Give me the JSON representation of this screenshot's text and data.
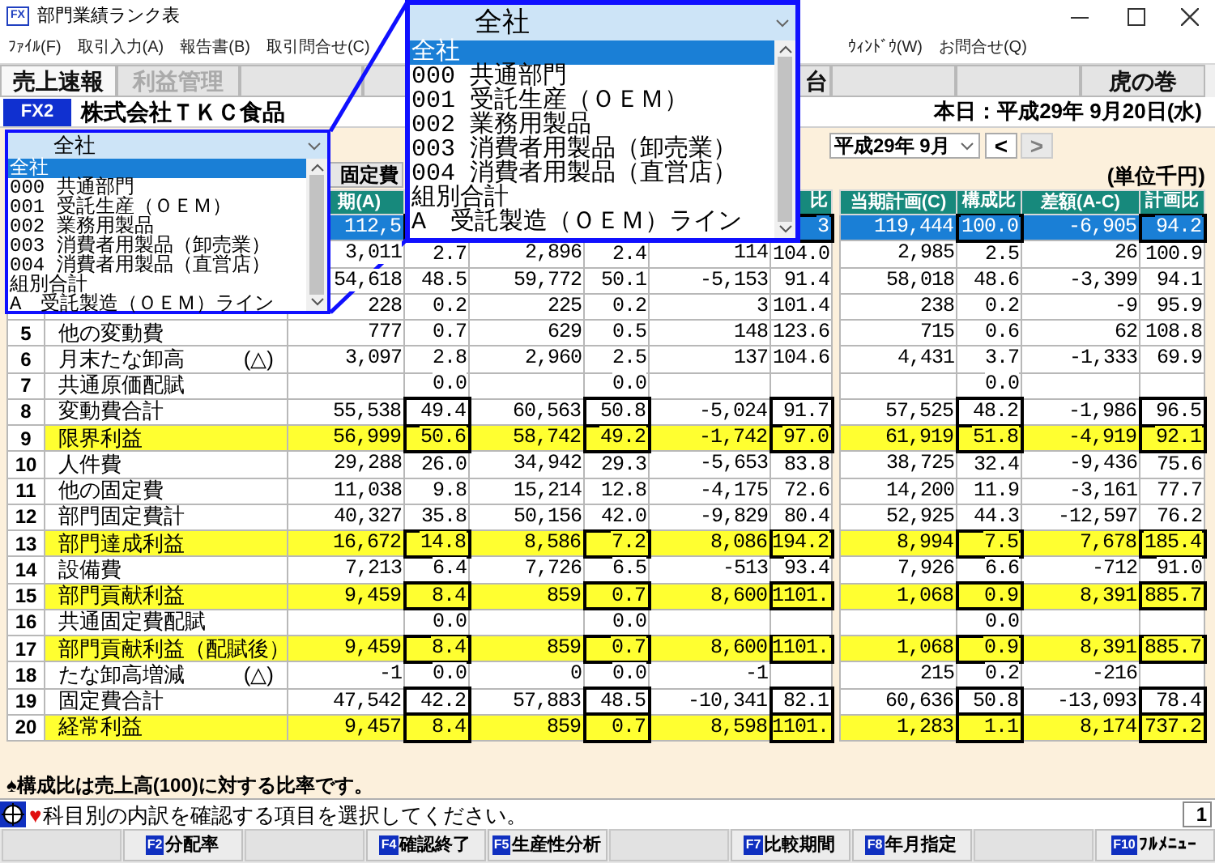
{
  "window": {
    "icon_label": "FX",
    "title": "部門業績ランク表"
  },
  "menu": [
    "ﾌｧｲﾙ(F)",
    "取引入力(A)",
    "報告書(B)",
    "取引問合せ(C)",
    "ｳｨﾝﾄﾞｳ(W)",
    "お問合せ(Q)"
  ],
  "tabs": [
    {
      "kind": "tab",
      "label": "売上速報",
      "selected": true,
      "disabled": false
    },
    {
      "kind": "tab",
      "label": "利益管理",
      "selected": false,
      "disabled": true
    },
    {
      "kind": "blank"
    },
    {
      "kind": "blank"
    },
    {
      "kind": "blank"
    },
    {
      "kind": "tab",
      "label": "台",
      "selected": false,
      "disabled": false
    },
    {
      "kind": "blank"
    },
    {
      "kind": "blank"
    },
    {
      "kind": "tab",
      "label": "虎の巻",
      "selected": false,
      "disabled": false
    }
  ],
  "company": {
    "code": "FX2",
    "name": "株式会社ＴＫＣ食品",
    "today": "本日：平成29年 9月20日(水)"
  },
  "period": {
    "value": "平成29年 9月",
    "prev": "<",
    "next": ">",
    "next_disabled": true
  },
  "unit": "(単位千円)",
  "toggle": "固定費",
  "table": {
    "header": {
      "column_3": "期(A)",
      "column_8": "比",
      "column_9": "当期計画(C)",
      "column_10": "構成比",
      "column_11": "差額(A-C)",
      "column_12": "計画比"
    },
    "rows": [
      {
        "kind": "total",
        "selected": true,
        "cells": [
          "112,5",
          null,
          null,
          null,
          null,
          "3",
          "119,444",
          "100.0",
          "-6,905",
          "94.2"
        ]
      },
      {
        "kind": "normal",
        "selected": false,
        "cells": [
          "3,011",
          "2.7",
          "2,896",
          "2.4",
          "114",
          "104.0",
          "2,985",
          "2.5",
          "26",
          "100.9"
        ]
      },
      {
        "kind": "normal",
        "selected": false,
        "cells": [
          "54,618",
          "48.5",
          "59,772",
          "50.1",
          "-5,153",
          "91.4",
          "58,018",
          "48.6",
          "-3,399",
          "94.1"
        ]
      },
      {
        "kind": "normal",
        "selected": false,
        "cells": [
          "228",
          "0.2",
          "225",
          "0.2",
          "3",
          "101.4",
          "238",
          "0.2",
          "-9",
          "95.9"
        ]
      },
      {
        "no": "5",
        "label": "他の変動費",
        "kind": "normal",
        "selected": false,
        "cells": [
          "777",
          "0.7",
          "629",
          "0.5",
          "148",
          "123.6",
          "715",
          "0.6",
          "62",
          "108.8"
        ]
      },
      {
        "no": "6",
        "label": "月末たな卸高",
        "sign": "(△)",
        "kind": "normal",
        "selected": false,
        "cells": [
          "3,097",
          "2.8",
          "2,960",
          "2.5",
          "137",
          "104.6",
          "4,431",
          "3.7",
          "-1,333",
          "69.9"
        ]
      },
      {
        "no": "7",
        "label": "共通原価配賦",
        "kind": "normal",
        "selected": false,
        "cells": [
          null,
          "0.0",
          null,
          "0.0",
          null,
          null,
          null,
          "0.0",
          null,
          null
        ]
      },
      {
        "no": "8",
        "label": "変動費合計",
        "kind": "total",
        "selected": false,
        "cells": [
          "55,538",
          "49.4",
          "60,563",
          "50.8",
          "-5,024",
          "91.7",
          "57,525",
          "48.2",
          "-1,986",
          "96.5"
        ]
      },
      {
        "no": "9",
        "label": "限界利益",
        "kind": "profit",
        "selected": false,
        "cells": [
          "56,999",
          "50.6",
          "58,742",
          "49.2",
          "-1,742",
          "97.0",
          "61,919",
          "51.8",
          "-4,919",
          "92.1"
        ]
      },
      {
        "no": "10",
        "label": "人件費",
        "kind": "normal",
        "selected": false,
        "cells": [
          "29,288",
          "26.0",
          "34,942",
          "29.3",
          "-5,653",
          "83.8",
          "38,725",
          "32.4",
          "-9,436",
          "75.6"
        ]
      },
      {
        "no": "11",
        "label": "他の固定費",
        "kind": "normal",
        "selected": false,
        "cells": [
          "11,038",
          "9.8",
          "15,214",
          "12.8",
          "-4,175",
          "72.6",
          "14,200",
          "11.9",
          "-3,161",
          "77.7"
        ]
      },
      {
        "no": "12",
        "label": "部門固定費計",
        "kind": "normal",
        "selected": false,
        "cells": [
          "40,327",
          "35.8",
          "50,156",
          "42.0",
          "-9,829",
          "80.4",
          "52,925",
          "44.3",
          "-12,597",
          "76.2"
        ]
      },
      {
        "no": "13",
        "label": "部門達成利益",
        "kind": "profit",
        "selected": false,
        "cells": [
          "16,672",
          "14.8",
          "8,586",
          "7.2",
          "8,086",
          "194.2",
          "8,994",
          "7.5",
          "7,678",
          "185.4"
        ]
      },
      {
        "no": "14",
        "label": "設備費",
        "kind": "normal",
        "selected": false,
        "cells": [
          "7,213",
          "6.4",
          "7,726",
          "6.5",
          "-513",
          "93.4",
          "7,926",
          "6.6",
          "-712",
          "91.0"
        ]
      },
      {
        "no": "15",
        "label": "部門貢献利益",
        "kind": "profit",
        "selected": false,
        "cells": [
          "9,459",
          "8.4",
          "859",
          "0.7",
          "8,600",
          "1101.",
          "1,068",
          "0.9",
          "8,391",
          "885.7"
        ]
      },
      {
        "no": "16",
        "label": "共通固定費配賦",
        "kind": "normal",
        "selected": false,
        "cells": [
          null,
          "0.0",
          null,
          "0.0",
          null,
          null,
          null,
          "0.0",
          null,
          null
        ]
      },
      {
        "no": "17",
        "label": "部門貢献利益（配賦後）",
        "kind": "profit",
        "selected": false,
        "cells": [
          "9,459",
          "8.4",
          "859",
          "0.7",
          "8,600",
          "1101.",
          "1,068",
          "0.9",
          "8,391",
          "885.7"
        ]
      },
      {
        "no": "18",
        "label": "たな卸高増減",
        "sign": "(△)",
        "kind": "normal",
        "selected": false,
        "cells": [
          "-1",
          "0.0",
          "0",
          "0.0",
          "-1",
          null,
          "215",
          "0.2",
          "-216",
          null
        ]
      },
      {
        "no": "19",
        "label": "固定費合計",
        "kind": "total",
        "selected": false,
        "cells": [
          "47,542",
          "42.2",
          "57,883",
          "48.5",
          "-10,341",
          "82.1",
          "60,636",
          "50.8",
          "-13,093",
          "78.4"
        ]
      },
      {
        "no": "20",
        "label": "経常利益",
        "kind": "profit",
        "selected": false,
        "cells": [
          "9,457",
          "8.4",
          "859",
          "0.7",
          "8,598",
          "1101.",
          "1,283",
          "1.1",
          "8,174",
          "737.2"
        ]
      }
    ]
  },
  "note": "♠構成比は売上高(100)に対する比率です。",
  "status": {
    "mark": "♥",
    "message": "科目別の内訳を確認する項目を選択してください。",
    "page": "1"
  },
  "function_keys": [
    {
      "kind": "blank"
    },
    {
      "kind": "key",
      "key": "F2",
      "label": "分配率"
    },
    {
      "kind": "blank"
    },
    {
      "kind": "key",
      "key": "F4",
      "label": "確認終了"
    },
    {
      "kind": "key",
      "key": "F5",
      "label": "生産性分析"
    },
    {
      "kind": "blank"
    },
    {
      "kind": "key",
      "key": "F7",
      "label": "比較期間"
    },
    {
      "kind": "key",
      "key": "F8",
      "label": "年月指定"
    },
    {
      "kind": "blank"
    },
    {
      "kind": "key",
      "key": "F10",
      "label": "ﾌﾙﾒﾆｭｰ"
    }
  ],
  "department_dropdown": {
    "value": "全社",
    "options": [
      {
        "label": "全社",
        "selected": true
      },
      {
        "label": "000 共通部門",
        "selected": false
      },
      {
        "label": "001 受託生産（ＯＥＭ）",
        "selected": false
      },
      {
        "label": "002 業務用製品",
        "selected": false
      },
      {
        "label": "003 消費者用製品（卸売業）",
        "selected": false
      },
      {
        "label": "004 消費者用製品（直営店）",
        "selected": false
      },
      {
        "label": "組別合計",
        "selected": false
      },
      {
        "label": "A　受託製造（ＯＥＭ）ライン",
        "selected": false
      }
    ]
  },
  "magnified_dropdown": {
    "value": "全社",
    "options": [
      {
        "label": "全社",
        "selected": true
      },
      {
        "label": "000 共通部門",
        "selected": false
      },
      {
        "label": "001 受託生産（ＯＥＭ）",
        "selected": false
      },
      {
        "label": "002 業務用製品",
        "selected": false
      },
      {
        "label": "003 消費者用製品（卸売業）",
        "selected": false
      },
      {
        "label": "004 消費者用製品（直営店）",
        "selected": false
      },
      {
        "label": "組別合計",
        "selected": false
      },
      {
        "label": "A　受託製造（ＯＥＭ）ライン",
        "selected": false
      }
    ]
  }
}
